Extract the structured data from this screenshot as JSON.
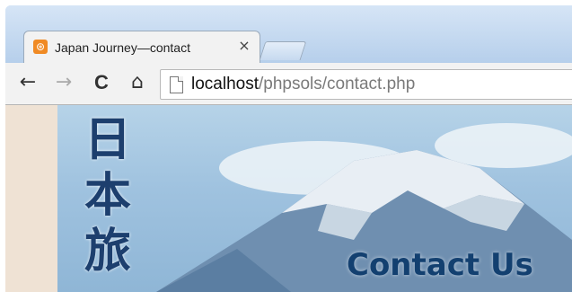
{
  "browser": {
    "tab": {
      "title": "Japan Journey—contact",
      "close_glyph": "×",
      "favicon": "xampp-icon"
    },
    "toolbar": {
      "back": "←",
      "forward": "→",
      "reload": "C",
      "home": "⌂"
    },
    "address": {
      "host": "localhost",
      "path": "/phpsols/contact.php"
    }
  },
  "page": {
    "logo_chars": [
      "日",
      "本",
      "旅"
    ],
    "heading": "Contact Us"
  },
  "colors": {
    "heading": "#134070",
    "sidebar": "#efe2d4",
    "sky": "#9fc2df"
  }
}
